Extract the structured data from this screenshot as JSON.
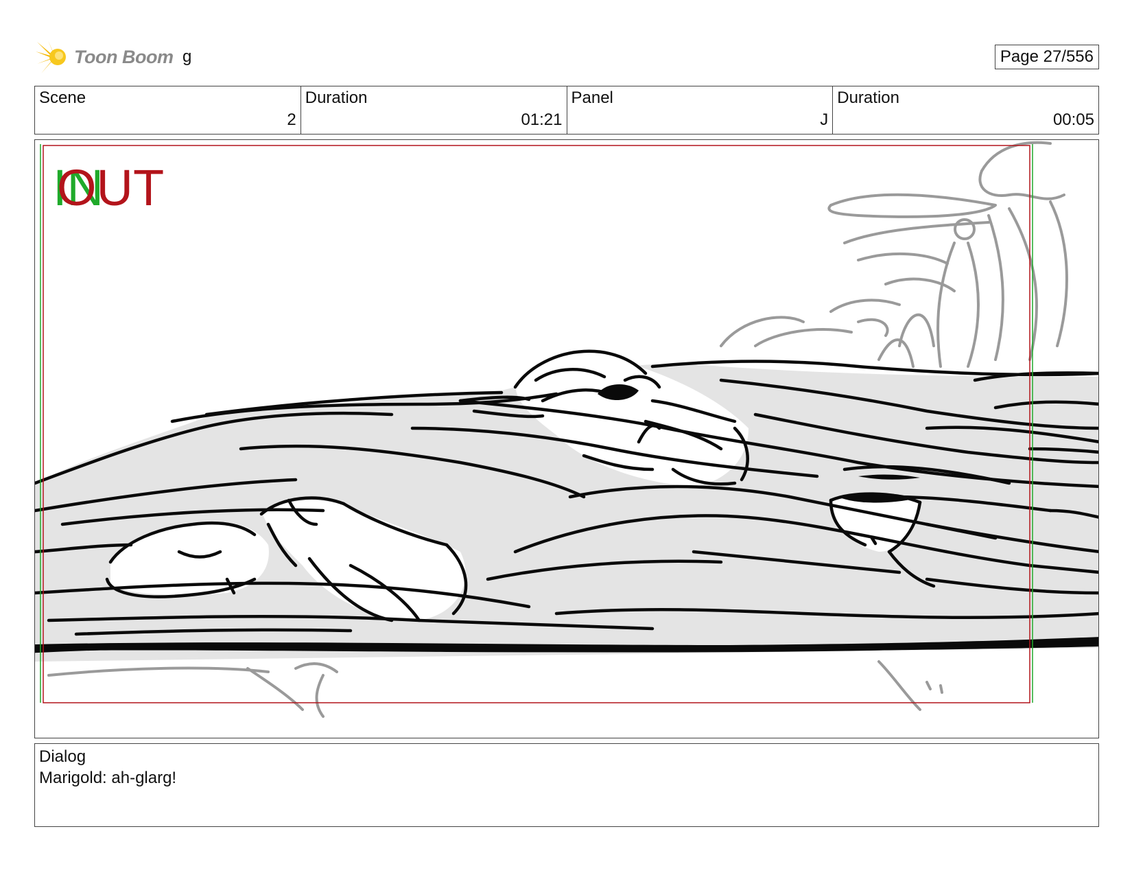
{
  "header": {
    "logo_text": "Toon Boom",
    "project_name": "g",
    "page_label": "Page",
    "page_value": "27/556"
  },
  "info": {
    "scene_label": "Scene",
    "scene_value": "2",
    "scene_duration_label": "Duration",
    "scene_duration_value": "01:21",
    "panel_label": "Panel",
    "panel_value": "J",
    "panel_duration_label": "Duration",
    "panel_duration_value": "00:05"
  },
  "panel": {
    "in_marker": "IN",
    "out_marker": "OUT",
    "colors": {
      "in": "#1faa2a",
      "out": "#b3141b",
      "safe_frame": "#b3141b",
      "fill": "#e4e4e4",
      "ink": "#0a0a0a",
      "gray": "#9a9a9a"
    }
  },
  "dialog": {
    "label": "Dialog",
    "text": "Marigold: ah-glarg!"
  }
}
